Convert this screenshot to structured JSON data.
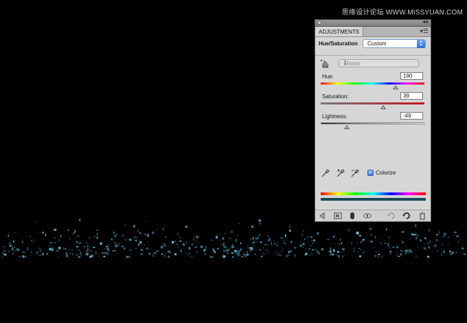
{
  "watermark": "思缘设计论坛 WWW.MISSYUAN.COM",
  "panel": {
    "tab": "ADJUSTMENTS",
    "title": "Hue/Saturation",
    "preset": "Custom",
    "channel": "Master",
    "hue": {
      "label": "Hue:",
      "value": "190",
      "percent": 0.72
    },
    "saturation": {
      "label": "Saturation:",
      "value": "39",
      "percent": 0.6
    },
    "lightness": {
      "label": "Lightness:",
      "value": "-49",
      "percent": 0.25
    },
    "colorize": {
      "label": "Colorize",
      "checked": true
    }
  },
  "colors": {
    "panel_bg": "#d6d6d6",
    "accent": "#2f6fd4",
    "tint": "#174a57",
    "city": "#5aa7c4"
  },
  "icons": [
    "panel-close-icon",
    "collapse-icon",
    "panel-menu-icon",
    "hand-adjust-icon",
    "eyedropper-icon",
    "eyedropper-plus-icon",
    "eyedropper-minus-icon",
    "back-arrow-icon",
    "clip-layer-icon",
    "mask-icon",
    "visibility-eye-icon",
    "reset-previous-icon",
    "reset-icon",
    "trash-icon"
  ]
}
